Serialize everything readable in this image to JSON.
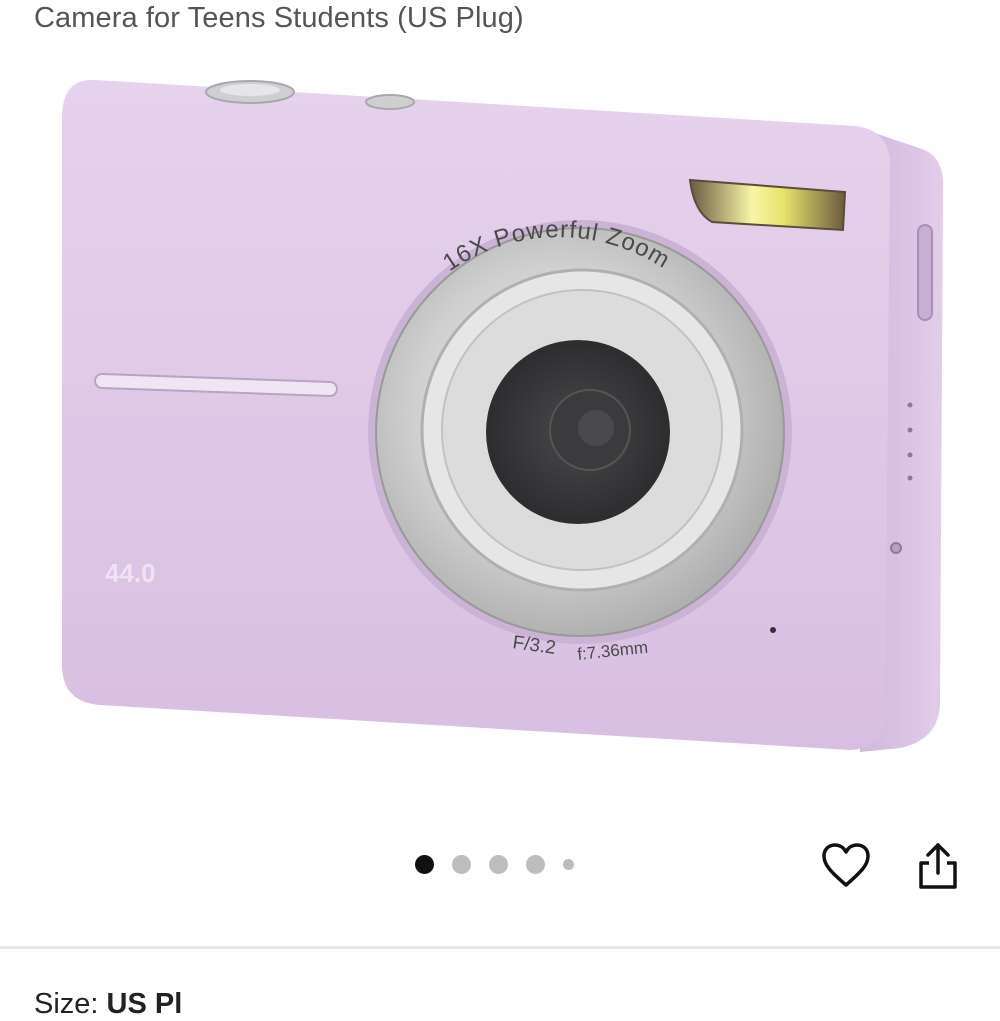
{
  "product": {
    "title": "Camera for Teens Students (US Plug)",
    "image_alt": "Purple digital camera",
    "lens_ring_text": "16X Powerful Zoom",
    "lens_aperture_text": "F/3.2",
    "lens_focal_text": "f:7.36mm",
    "badge_text": "44.0",
    "body_color": "#dcc4e4"
  },
  "carousel": {
    "total": 5,
    "active_index": 0
  },
  "actions": {
    "favorite_icon": "heart-icon",
    "share_icon": "share-icon"
  },
  "size": {
    "label": "Size:",
    "value": "US Pl"
  }
}
